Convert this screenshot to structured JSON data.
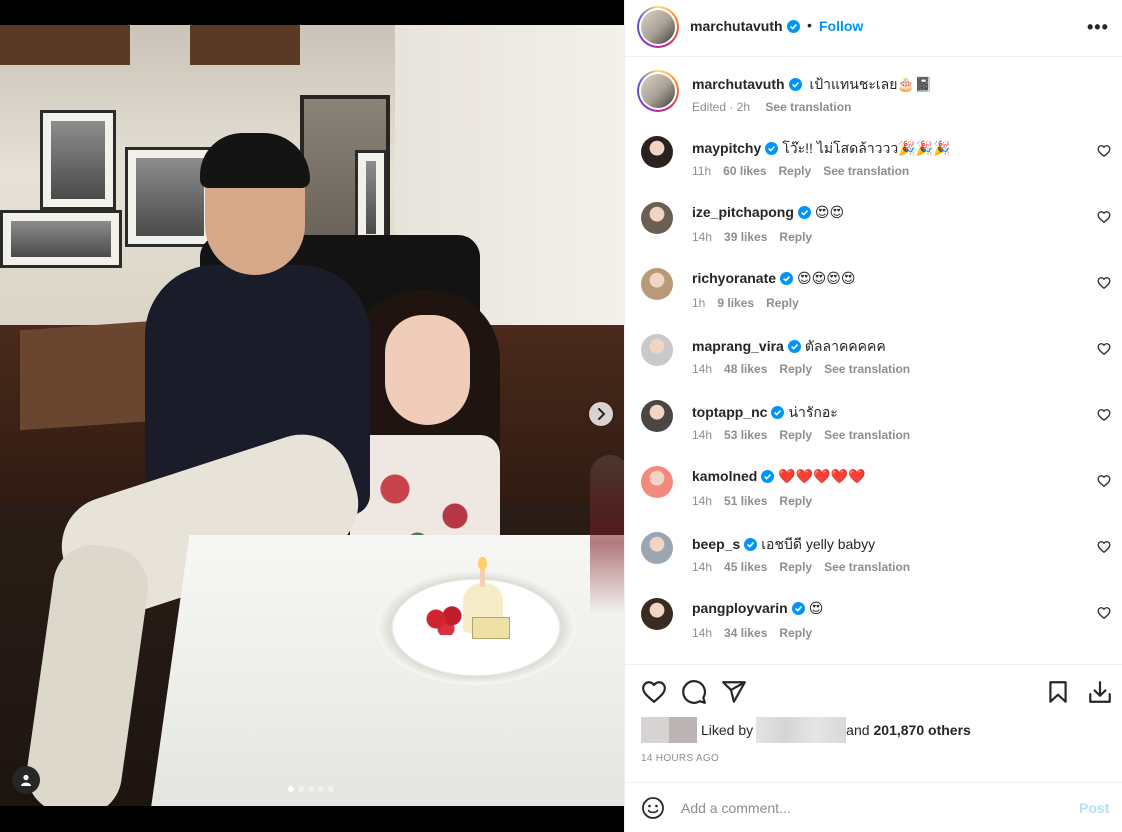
{
  "post_author": {
    "username": "marchutavuth",
    "verified": true,
    "follow_label": "Follow",
    "dot": "•",
    "more_label": "•••"
  },
  "caption": {
    "username": "marchutavuth",
    "text": "เป้าแทนชะเลย🎂📓",
    "edited": "Edited · 2h",
    "see_translation": "See translation"
  },
  "comments": [
    {
      "username": "maypitchy",
      "text": "โว๊ะ!! ไม่โสดล้าววว🎉🎉🎉",
      "time": "11h",
      "likes": "60 likes",
      "reply": "Reply",
      "translation": "See translation",
      "avatar_color": "#2b2220"
    },
    {
      "username": "ize_pitchapong",
      "text": "😍😍",
      "time": "14h",
      "likes": "39 likes",
      "reply": "Reply",
      "translation": "",
      "avatar_color": "#6a5f52"
    },
    {
      "username": "richyoranate",
      "text": "😍😍😍😍",
      "time": "1h",
      "likes": "9 likes",
      "reply": "Reply",
      "translation": "",
      "avatar_color": "#b89a78"
    },
    {
      "username": "maprang_vira",
      "text": "ตัลลาคคคคค",
      "time": "14h",
      "likes": "48 likes",
      "reply": "Reply",
      "translation": "See translation",
      "avatar_color": "#c9c9c9"
    },
    {
      "username": "toptapp_nc",
      "text": "น่ารักอะ",
      "time": "14h",
      "likes": "53 likes",
      "reply": "Reply",
      "translation": "See translation",
      "avatar_color": "#4a4644"
    },
    {
      "username": "kamolned",
      "text": "❤️❤️❤️❤️❤️",
      "time": "14h",
      "likes": "51 likes",
      "reply": "Reply",
      "translation": "",
      "avatar_color": "#f28b7d"
    },
    {
      "username": "beep_s",
      "text": "เอชบีดี yelly babyy",
      "time": "14h",
      "likes": "45 likes",
      "reply": "Reply",
      "translation": "See translation",
      "avatar_color": "#9aa6b2"
    },
    {
      "username": "pangployvarin",
      "text": "😍",
      "time": "14h",
      "likes": "34 likes",
      "reply": "Reply",
      "translation": "",
      "avatar_color": "#3a2a22"
    }
  ],
  "likes": {
    "liked_by": "Liked by",
    "and": "and",
    "count": "201,870 others"
  },
  "timestamp": "14 HOURS AGO",
  "add_comment": {
    "placeholder": "Add a comment...",
    "post_label": "Post"
  },
  "carousel": {
    "total": 5,
    "active_index": 0
  },
  "colors": {
    "accent": "#0095f6",
    "verified": "#0095f6",
    "post_disabled": "#b2dffc",
    "muted": "#8e8e8e"
  },
  "icons": [
    "chevron-right-icon",
    "user-tag-icon",
    "heart-icon",
    "comment-icon",
    "share-icon",
    "bookmark-icon",
    "download-icon",
    "emoji-icon",
    "verified-badge-icon",
    "more-options-icon"
  ]
}
